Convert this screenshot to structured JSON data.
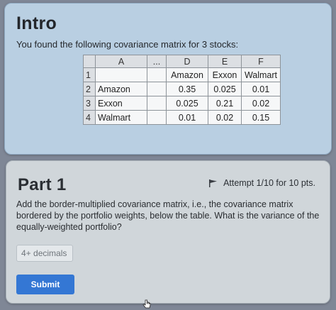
{
  "intro": {
    "title": "Intro",
    "text": "You found the following covariance matrix for 3 stocks:"
  },
  "table": {
    "columns": [
      "A",
      "...",
      "D",
      "E",
      "F"
    ],
    "rows": [
      {
        "num": "1",
        "label": "",
        "values": [
          "Amazon",
          "Exxon",
          "Walmart"
        ]
      },
      {
        "num": "2",
        "label": "Amazon",
        "values": [
          "0.35",
          "0.025",
          "0.01"
        ]
      },
      {
        "num": "3",
        "label": "Exxon",
        "values": [
          "0.025",
          "0.21",
          "0.02"
        ]
      },
      {
        "num": "4",
        "label": "Walmart",
        "values": [
          "0.01",
          "0.02",
          "0.15"
        ]
      }
    ]
  },
  "part1": {
    "title": "Part 1",
    "attempt": "Attempt 1/10 for 10 pts.",
    "question": "Add the border-multiplied covariance matrix, i.e., the covariance matrix bordered by the portfolio weights, below the table. What is the variance of the equally-weighted portfolio?",
    "input_placeholder": "4+ decimals",
    "submit_label": "Submit"
  },
  "colors": {
    "intro_card": "#b9cfe2",
    "part_card": "#d0d6da",
    "submit_button": "#3477d4"
  },
  "icons": [
    "flag-icon",
    "cursor-hand-icon"
  ]
}
